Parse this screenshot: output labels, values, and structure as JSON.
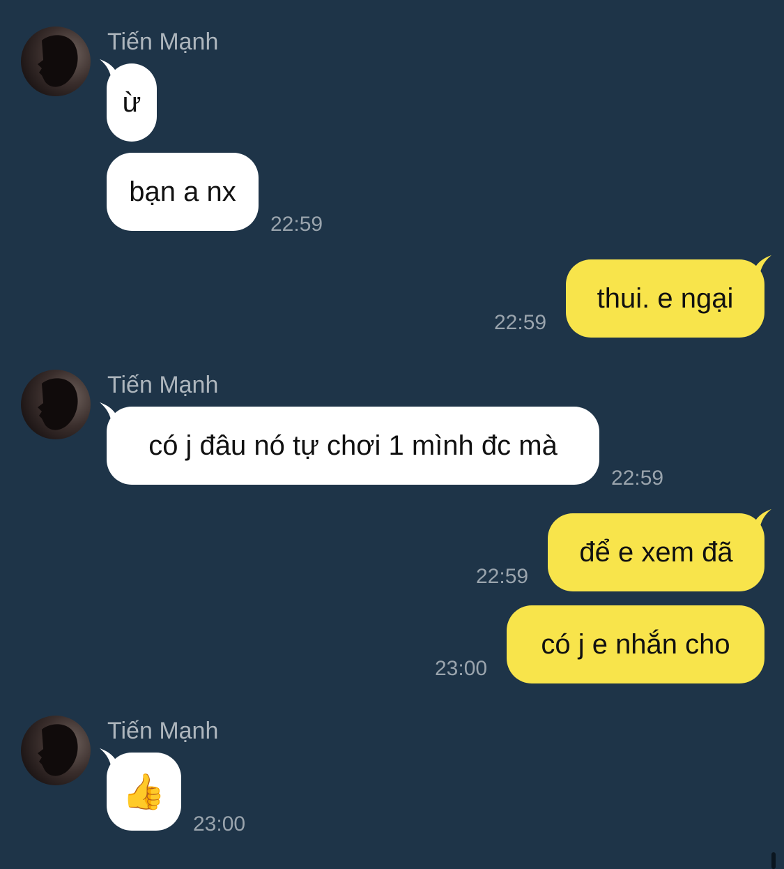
{
  "messages": [
    {
      "sender": "Tiến Mạnh",
      "text": "ừ"
    },
    {
      "text": "bạn a nx",
      "time": "22:59"
    },
    {
      "text": "thui. e ngại",
      "time": "22:59"
    },
    {
      "sender": "Tiến Mạnh",
      "text": "có j đâu nó tự chơi 1 mình đc mà",
      "time": "22:59"
    },
    {
      "text": "để e xem đã",
      "time": "22:59"
    },
    {
      "text": "có j e nhắn cho",
      "time": "23:00"
    },
    {
      "sender": "Tiến Mạnh",
      "text": "👍",
      "time": "23:00"
    }
  ],
  "colors": {
    "background": "#1e3448",
    "incoming_bubble": "#ffffff",
    "outgoing_bubble": "#f8e44b"
  },
  "icons": {
    "avatar": "avatar-photo",
    "emoji": "thumbs-up"
  }
}
